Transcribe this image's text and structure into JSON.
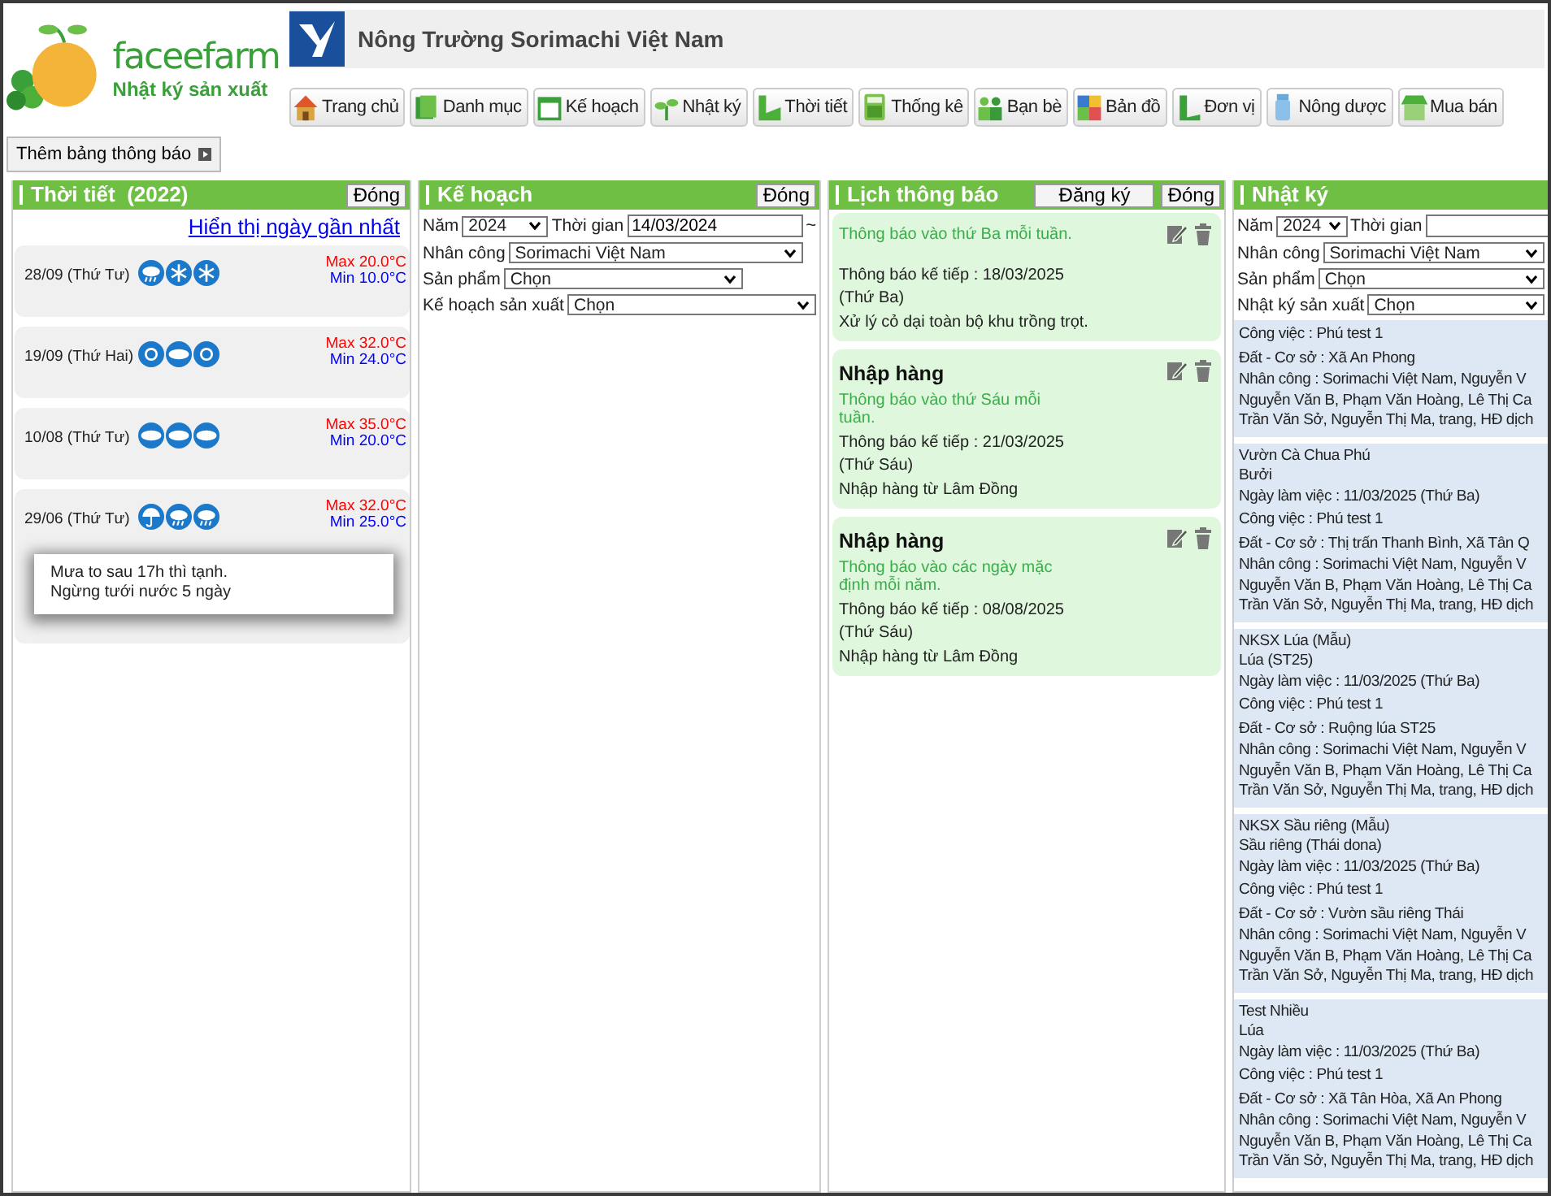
{
  "logo": {
    "name": "faceefarm",
    "tagline": "Nhật ký sản xuất"
  },
  "company": "Nông Trường Sorimachi Việt Nam",
  "nav": [
    {
      "label": "Trang chủ"
    },
    {
      "label": "Danh mục"
    },
    {
      "label": "Kế hoạch"
    },
    {
      "label": "Nhật ký"
    },
    {
      "label": "Thời tiết"
    },
    {
      "label": "Thống kê"
    },
    {
      "label": "Bạn bè"
    },
    {
      "label": "Bản đồ"
    },
    {
      "label": "Đơn vị"
    },
    {
      "label": "Nông dược"
    },
    {
      "label": "Mua bán"
    }
  ],
  "add_board_button": "Thêm bảng thông báo",
  "weather": {
    "title": "Thời tiết  (2022)",
    "close": "Đóng",
    "link": "Hiển thị ngày gần nhất",
    "days": [
      {
        "date": "28/09 (Thứ Tư)",
        "max": "Max 20.0°C",
        "min": "Min 10.0°C"
      },
      {
        "date": "19/09 (Thứ Hai)",
        "max": "Max 32.0°C",
        "min": "Min 24.0°C"
      },
      {
        "date": "10/08 (Thứ Tư)",
        "max": "Max 35.0°C",
        "min": "Min 20.0°C"
      },
      {
        "date": "29/06 (Thứ Tư)",
        "max": "Max 32.0°C",
        "min": "Min 25.0°C",
        "note": [
          "Mưa to sau 17h thì tạnh.",
          "Ngừng tưới nước 5 ngày"
        ]
      }
    ]
  },
  "plan": {
    "title": "Kế hoạch",
    "close": "Đóng",
    "filters": [
      [
        {
          "label": "Năm",
          "kind": "select",
          "value": "2024"
        },
        {
          "label": "Thời gian",
          "kind": "date",
          "value": "14/03/2024",
          "suffix": "~"
        }
      ],
      [
        {
          "label": "Nhân công",
          "kind": "select",
          "value": "Sorimachi Việt Nam"
        }
      ],
      [
        {
          "label": "Sản phẩm",
          "kind": "select",
          "value": "Chọn"
        }
      ],
      [
        {
          "label": "Kế hoạch sản xuất",
          "kind": "select",
          "value": "Chọn"
        }
      ]
    ]
  },
  "schedule": {
    "title": "Lịch thông báo",
    "register": "Đăng ký",
    "close": "Đóng",
    "items": [
      {
        "repeat": "Thông báo vào thứ Ba mỗi tuần.",
        "next": "Thông báo kế tiếp : 18/03/2025",
        "weekday": "(Thứ Ba)",
        "content": "Xử lý cỏ dại toàn bộ khu trồng trọt."
      },
      {
        "title": "Nhập hàng",
        "repeat": "Thông báo vào thứ Sáu mỗi tuần.",
        "next": "Thông báo kế tiếp : 21/03/2025",
        "weekday": "(Thứ Sáu)",
        "content": "Nhập hàng từ Lâm Đồng"
      },
      {
        "title": "Nhập hàng",
        "repeat": "Thông báo vào các ngày mặc định mỗi năm.",
        "next": "Thông báo kế tiếp : 08/08/2025",
        "weekday": "(Thứ Sáu)",
        "content": "Nhập hàng từ Lâm Đồng"
      }
    ]
  },
  "diary": {
    "title": "Nhật ký",
    "filters": [
      [
        {
          "label": "Năm",
          "kind": "select",
          "value": "2024"
        },
        {
          "label": "Thời gian",
          "kind": "date"
        }
      ],
      [
        {
          "label": "Nhân công",
          "kind": "select",
          "value": "Sorimachi Việt Nam"
        }
      ],
      [
        {
          "label": "Sản phẩm",
          "kind": "select",
          "value": "Chọn"
        }
      ],
      [
        {
          "label": "Nhật ký sản xuất",
          "kind": "select",
          "value": "Chọn"
        }
      ]
    ],
    "entries": [
      {
        "details": [
          "Công việc : Phú test 1",
          "Đất - Cơ sở : Xã An Phong"
        ],
        "workers": [
          "Nhân công : Sorimachi Việt Nam, Nguyễn V",
          "Nguyễn Văn B, Phạm Văn Hoàng, Lê Thị Ca",
          "Trần Văn Sở, Nguyễn Thị Ma, trang, HĐ dịch"
        ]
      },
      {
        "title": [
          "Vườn Cà Chua Phú",
          "Bưởi"
        ],
        "details": [
          "Ngày làm việc : 11/03/2025 (Thứ Ba)",
          "Công việc : Phú test 1",
          "Đất - Cơ sở : Thị trấn Thanh Bình, Xã Tân Q"
        ],
        "workers": [
          "Nhân công : Sorimachi Việt Nam, Nguyễn V",
          "Nguyễn Văn B, Phạm Văn Hoàng, Lê Thị Ca",
          "Trần Văn Sở, Nguyễn Thị Ma, trang, HĐ dịch"
        ]
      },
      {
        "title": [
          "NKSX Lúa (Mẫu)",
          "Lúa  (ST25)"
        ],
        "details": [
          "Ngày làm việc : 11/03/2025 (Thứ Ba)",
          "Công việc : Phú test 1",
          "Đất - Cơ sở : Ruộng lúa ST25"
        ],
        "workers": [
          "Nhân công : Sorimachi Việt Nam, Nguyễn V",
          "Nguyễn Văn B, Phạm Văn Hoàng, Lê Thị Ca",
          "Trần Văn Sở, Nguyễn Thị Ma, trang, HĐ dịch"
        ]
      },
      {
        "title": [
          "NKSX Sầu riêng (Mẫu)",
          "Sầu riêng  (Thái dona)"
        ],
        "details": [
          "Ngày làm việc : 11/03/2025 (Thứ Ba)",
          "Công việc : Phú test 1",
          "Đất - Cơ sở : Vườn sầu riêng Thái"
        ],
        "workers": [
          "Nhân công : Sorimachi Việt Nam, Nguyễn V",
          "Nguyễn Văn B, Phạm Văn Hoàng, Lê Thị Ca",
          "Trần Văn Sở, Nguyễn Thị Ma, trang, HĐ dịch"
        ]
      },
      {
        "title": [
          "Test Nhiều",
          "Lúa"
        ],
        "details": [
          "Ngày làm việc : 11/03/2025 (Thứ Ba)",
          "Công việc : Phú test 1",
          "Đất - Cơ sở : Xã Tân Hòa, Xã An Phong"
        ],
        "workers": [
          "Nhân công : Sorimachi Việt Nam, Nguyễn V",
          "Nguyễn Văn B, Phạm Văn Hoàng, Lê Thị Ca",
          "Trần Văn Sở, Nguyễn Thị Ma, trang, HĐ dịch"
        ]
      }
    ]
  }
}
